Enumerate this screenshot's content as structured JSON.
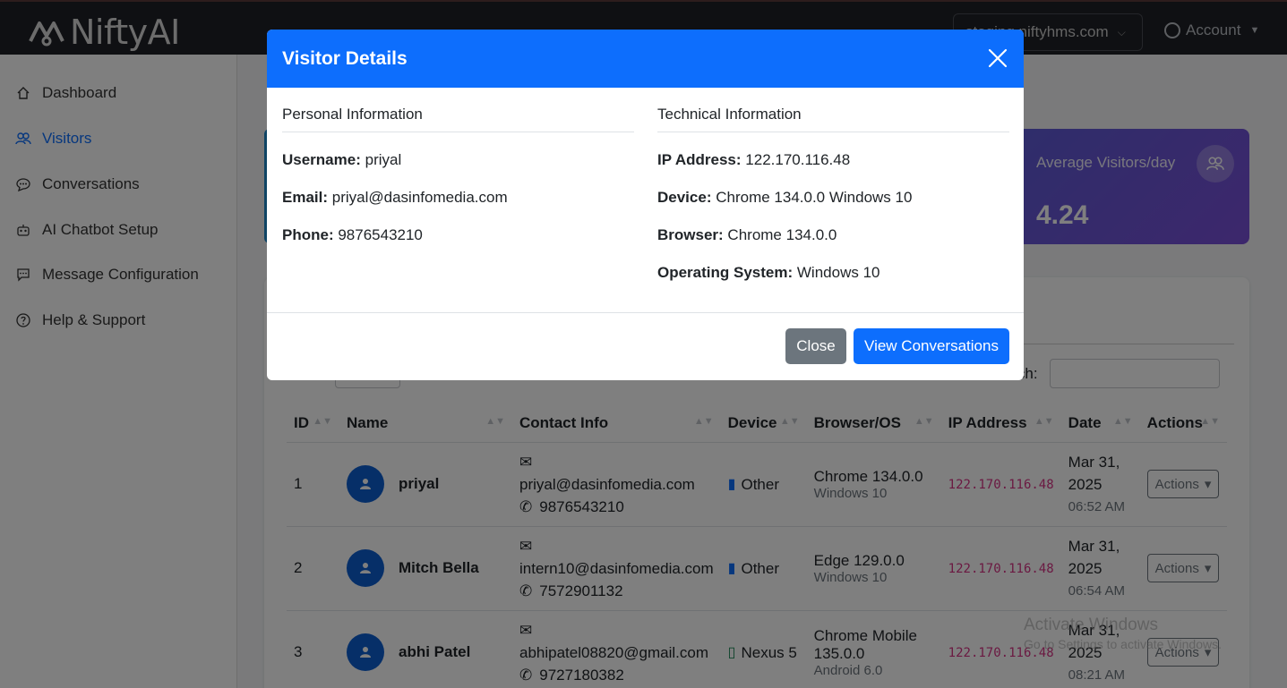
{
  "app": {
    "logo_text": "NiftyAI",
    "domain": "staging.niftyhms.com",
    "account_label": "Account"
  },
  "sidebar": {
    "items": [
      {
        "label": "Dashboard",
        "icon": "home-icon",
        "active": false
      },
      {
        "label": "Visitors",
        "icon": "users-icon",
        "active": true
      },
      {
        "label": "Conversations",
        "icon": "chat-icon",
        "active": false
      },
      {
        "label": "AI Chatbot Setup",
        "icon": "robot-icon",
        "active": false
      },
      {
        "label": "Message Configuration",
        "icon": "message-settings-icon",
        "active": false
      },
      {
        "label": "Help & Support",
        "icon": "question-icon",
        "active": false
      }
    ]
  },
  "stats": {
    "avg_label": "Average Visitors/day",
    "avg_value": "4.24"
  },
  "table": {
    "search_label": "Search:",
    "columns": [
      "ID",
      "Name",
      "Contact Info",
      "Device",
      "Browser/OS",
      "IP Address",
      "Date",
      "Actions"
    ],
    "rows": [
      {
        "id": "1",
        "name": "priyal",
        "email": "priyal@dasinfomedia.com",
        "phone": "9876543210",
        "device": "Other",
        "browser": "Chrome 134.0.0",
        "os": "Windows 10",
        "ip": "122.170.116.48",
        "date": "Mar 31, 2025",
        "time": "06:52 AM",
        "action": "Actions"
      },
      {
        "id": "2",
        "name": "Mitch Bella",
        "email": "intern10@dasinfomedia.com",
        "phone": "7572901132",
        "device": "Other",
        "browser": "Edge 129.0.0",
        "os": "Windows 10",
        "ip": "122.170.116.48",
        "date": "Mar 31, 2025",
        "time": "06:54 AM",
        "action": "Actions"
      },
      {
        "id": "3",
        "name": "abhi Patel",
        "email": "abhipatel08820@gmail.com",
        "phone": "9727180382",
        "device": "Nexus 5",
        "browser": "Chrome Mobile 135.0.0",
        "os": "Android 6.0",
        "ip": "122.170.116.48",
        "date": "Mar 31, 2025",
        "time": "08:21 AM",
        "action": "Actions"
      }
    ]
  },
  "watermark": {
    "title": "Activate Windows",
    "subtitle": "Go to Settings to activate Windows."
  },
  "modal": {
    "title": "Visitor Details",
    "personal": {
      "heading": "Personal Information",
      "username_label": "Username:",
      "username": "priyal",
      "email_label": "Email:",
      "email": "priyal@dasinfomedia.com",
      "phone_label": "Phone:",
      "phone": "9876543210"
    },
    "technical": {
      "heading": "Technical Information",
      "ip_label": "IP Address:",
      "ip": "122.170.116.48",
      "device_label": "Device:",
      "device": "Chrome 134.0.0 Windows 10",
      "browser_label": "Browser:",
      "browser": "Chrome 134.0.0",
      "os_label": "Operating System:",
      "os": "Windows 10"
    },
    "close_label": "Close",
    "view_label": "View Conversations"
  },
  "colors": {
    "primary": "#0d6efd",
    "secondary": "#6c757d",
    "navbar": "#1f2126",
    "ip_text": "#d63384"
  }
}
